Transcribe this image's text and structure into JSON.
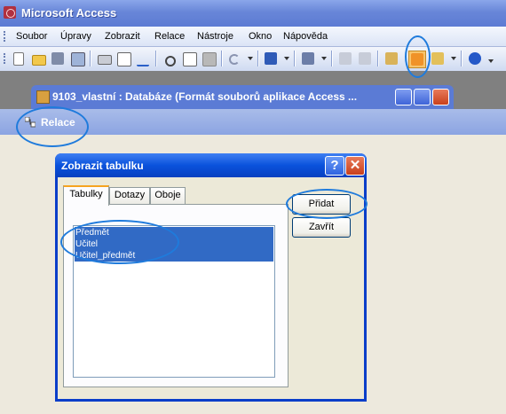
{
  "app": {
    "title": "Microsoft Access"
  },
  "menu": [
    "Soubor",
    "Úpravy",
    "Zobrazit",
    "Relace",
    "Nástroje",
    "Okno",
    "Nápověda"
  ],
  "db_window": {
    "title": "9103_vlastní : Databáze (Formát souborů aplikace Access ..."
  },
  "relace_window": {
    "title": "Relace"
  },
  "dialog": {
    "title": "Zobrazit tabulku",
    "tabs": [
      "Tabulky",
      "Dotazy",
      "Oboje"
    ],
    "active_tab": "Tabulky",
    "tables": [
      "Předmět",
      "Učitel",
      "Učitel_předmět"
    ],
    "add_label": "Přidat",
    "close_label": "Zavřít"
  },
  "colors": {
    "selection": "#316ac5",
    "title_blue": "#0a52dc",
    "highlight_ring": "#1f7bdc"
  }
}
